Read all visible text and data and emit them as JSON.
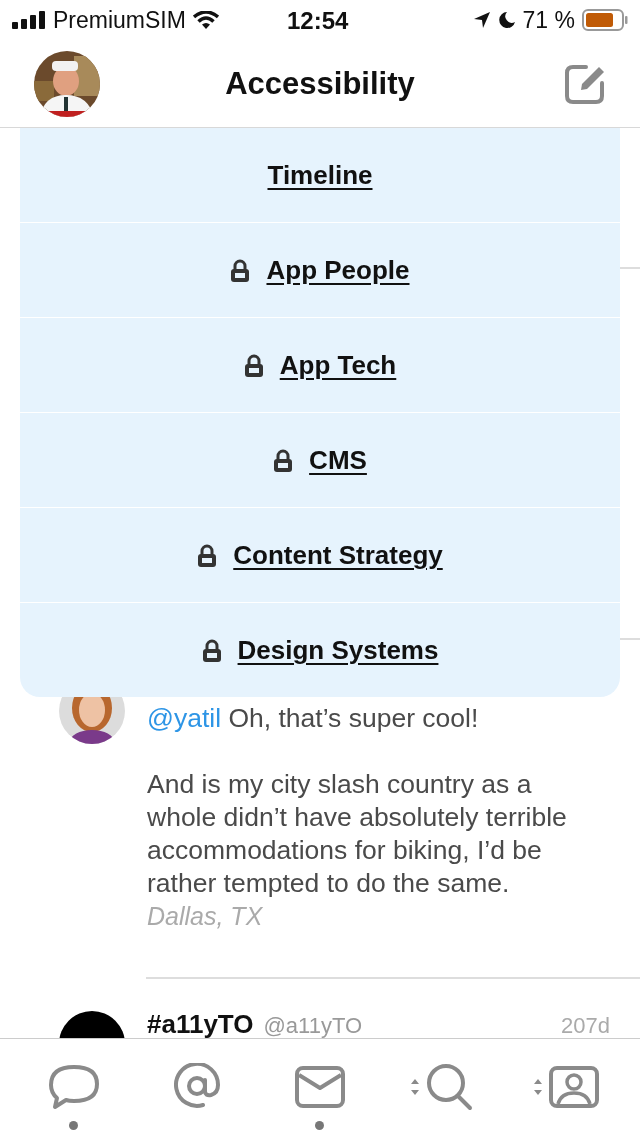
{
  "status_bar": {
    "carrier": "PremiumSIM",
    "time": "12:54",
    "battery": "71 %"
  },
  "header": {
    "title": "Accessibility"
  },
  "list_menu": {
    "items": [
      {
        "label": "Timeline",
        "locked": false
      },
      {
        "label": "App People",
        "locked": true
      },
      {
        "label": "App Tech",
        "locked": true
      },
      {
        "label": "CMS",
        "locked": true
      },
      {
        "label": "Content Strategy",
        "locked": true
      },
      {
        "label": "Design Systems",
        "locked": true
      }
    ]
  },
  "tweets": [
    {
      "mention": "@yatil",
      "text": "Oh, that’s super cool!\n\nAnd is my city slash country as a whole didn’t have absolutely terrible accommodations for biking, I’d be rather tempted to do the same.",
      "location": "Dallas, TX"
    },
    {
      "name": "#a11yTO",
      "handle": "@a11yTO",
      "time": "207d"
    }
  ],
  "tab_bar": [
    {
      "kind": "chat",
      "dot": true,
      "switcher": false
    },
    {
      "kind": "mention",
      "dot": false,
      "switcher": false
    },
    {
      "kind": "mail",
      "dot": true,
      "switcher": false
    },
    {
      "kind": "search",
      "dot": false,
      "switcher": true
    },
    {
      "kind": "profile",
      "dot": false,
      "switcher": true
    }
  ]
}
